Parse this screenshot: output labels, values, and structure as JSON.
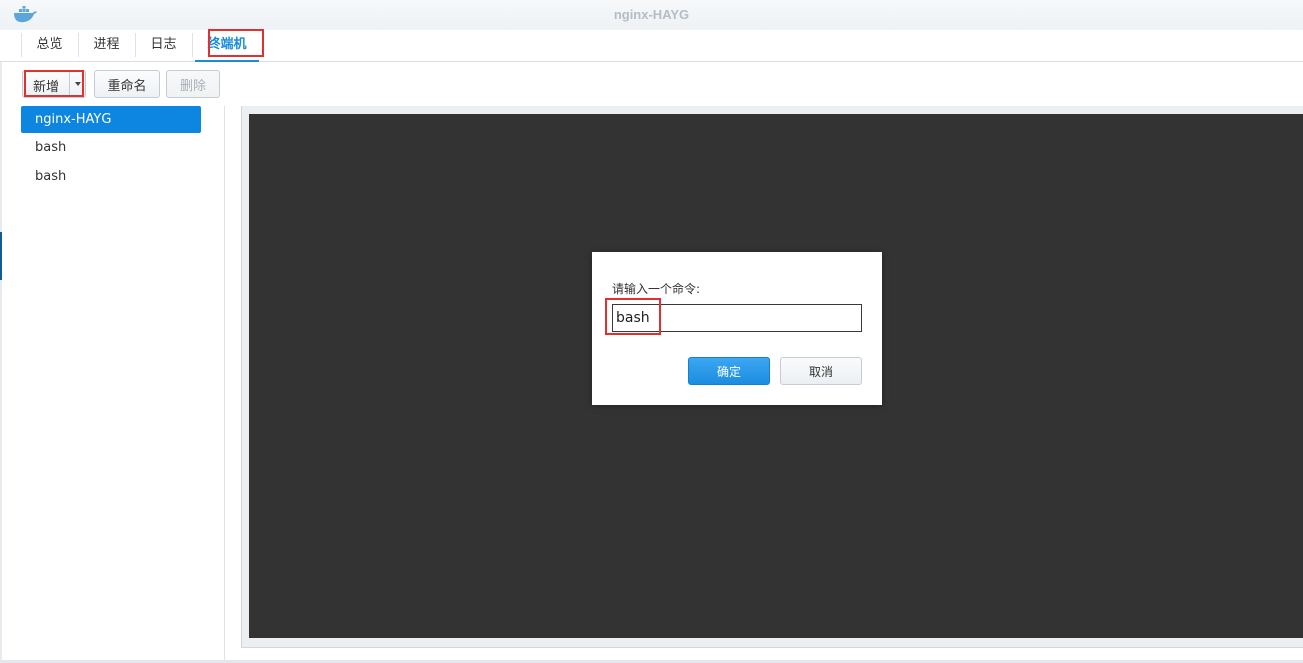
{
  "window": {
    "title": "nginx-HAYG",
    "icon": "docker-whale-icon"
  },
  "tabs": [
    {
      "label": "总览"
    },
    {
      "label": "进程"
    },
    {
      "label": "日志"
    },
    {
      "label": "终端机",
      "active": true
    }
  ],
  "toolbar": {
    "add_label": "新增",
    "rename_label": "重命名",
    "delete_label": "删除"
  },
  "sessions": [
    {
      "label": "nginx-HAYG",
      "selected": true
    },
    {
      "label": "bash"
    },
    {
      "label": "bash"
    }
  ],
  "dialog": {
    "prompt": "请输入一个命令:",
    "command_value": "bash",
    "ok_label": "确定",
    "cancel_label": "取消"
  },
  "colors": {
    "accent": "#1a8cd8",
    "selected_bg": "#0d86e1",
    "terminal_bg": "#333333",
    "highlight_box": "#e03030"
  }
}
